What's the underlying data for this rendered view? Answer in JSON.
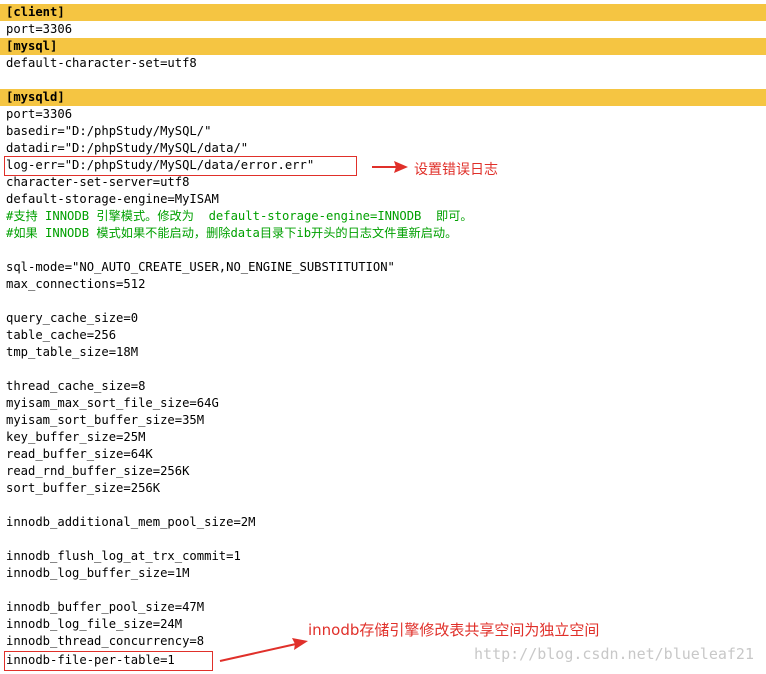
{
  "lines": [
    "[client]",
    "port=3306",
    "[mysql]",
    "default-character-set=utf8",
    "",
    "[mysqld]",
    "port=3306",
    "basedir=\"D:/phpStudy/MySQL/\"",
    "datadir=\"D:/phpStudy/MySQL/data/\"",
    "log-err=\"D:/phpStudy/MySQL/data/error.err\"",
    "character-set-server=utf8",
    "default-storage-engine=MyISAM",
    "#支持 INNODB 引擎模式。修改为  default-storage-engine=INNODB  即可。",
    "#如果 INNODB 模式如果不能启动，删除data目录下ib开头的日志文件重新启动。",
    "",
    "sql-mode=\"NO_AUTO_CREATE_USER,NO_ENGINE_SUBSTITUTION\"",
    "max_connections=512",
    "",
    "query_cache_size=0",
    "table_cache=256",
    "tmp_table_size=18M",
    "",
    "thread_cache_size=8",
    "myisam_max_sort_file_size=64G",
    "myisam_sort_buffer_size=35M",
    "key_buffer_size=25M",
    "read_buffer_size=64K",
    "read_rnd_buffer_size=256K",
    "sort_buffer_size=256K",
    "",
    "innodb_additional_mem_pool_size=2M",
    "",
    "innodb_flush_log_at_trx_commit=1",
    "innodb_log_buffer_size=1M",
    "",
    "innodb_buffer_pool_size=47M",
    "innodb_log_file_size=24M",
    "innodb_thread_concurrency=8",
    "innodb-file-per-table=1"
  ],
  "annotations": {
    "log_err_note": "设置错误日志",
    "innodb_note": "innodb存储引擎修改表共享空间为独立空间"
  },
  "watermark": "http://blog.csdn.net/blueleaf21",
  "colors": {
    "section_highlight": "#f5c542",
    "comment": "#00a000",
    "annotation": "#e0302a"
  }
}
